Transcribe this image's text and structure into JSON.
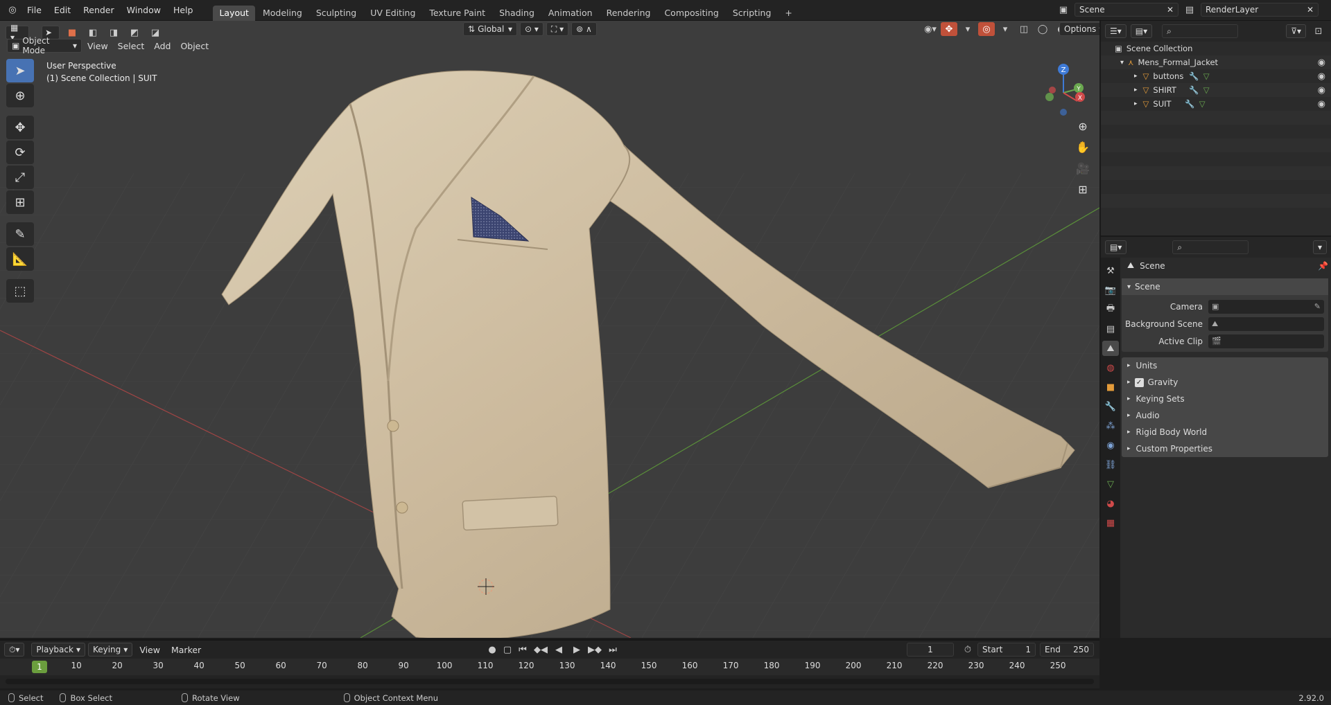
{
  "topbar": {
    "menus": [
      "File",
      "Edit",
      "Render",
      "Window",
      "Help"
    ],
    "workspaces": [
      "Layout",
      "Modeling",
      "Sculpting",
      "UV Editing",
      "Texture Paint",
      "Shading",
      "Animation",
      "Rendering",
      "Compositing",
      "Scripting"
    ],
    "active_workspace": "Layout",
    "add_tab": "+",
    "scene": "Scene",
    "view_layer": "RenderLayer"
  },
  "viewport": {
    "mode": "Object Mode",
    "menus": [
      "View",
      "Select",
      "Add",
      "Object"
    ],
    "orientation": "Global",
    "options": "Options",
    "perspective": "User Perspective",
    "collection_info": "(1) Scene Collection | SUIT",
    "gizmo": {
      "z": "Z",
      "y": "Y",
      "x": "X"
    }
  },
  "outliner": {
    "root": "Scene Collection",
    "collection": "Mens_Formal_Jacket",
    "objects": [
      "buttons",
      "SHIRT",
      "SUIT"
    ]
  },
  "properties": {
    "header": "Scene",
    "panel_title": "Scene",
    "fields": [
      {
        "label": "Camera"
      },
      {
        "label": "Background Scene"
      },
      {
        "label": "Active Clip"
      }
    ],
    "subpanels": [
      "Units",
      "Gravity",
      "Keying Sets",
      "Audio",
      "Rigid Body World",
      "Custom Properties"
    ],
    "gravity_checked": true
  },
  "timeline": {
    "menus": [
      "Playback",
      "Keying",
      "View",
      "Marker"
    ],
    "current_frame": "1",
    "start_label": "Start",
    "start_value": "1",
    "end_label": "End",
    "end_value": "250",
    "ticks": [
      "1",
      "10",
      "20",
      "30",
      "40",
      "50",
      "60",
      "70",
      "80",
      "90",
      "100",
      "110",
      "120",
      "130",
      "140",
      "150",
      "160",
      "170",
      "180",
      "190",
      "200",
      "210",
      "220",
      "230",
      "240",
      "250"
    ]
  },
  "status": {
    "items": [
      "Select",
      "Box Select",
      "Rotate View",
      "Object Context Menu"
    ],
    "version": "2.92.0"
  },
  "colors": {
    "accent": "#4772b3",
    "frame": "#6b9e3e",
    "x_axis": "#d04a4a",
    "y_axis": "#6aa84f",
    "z_axis": "#3e7ad6",
    "jacket": "#cbb99c"
  }
}
